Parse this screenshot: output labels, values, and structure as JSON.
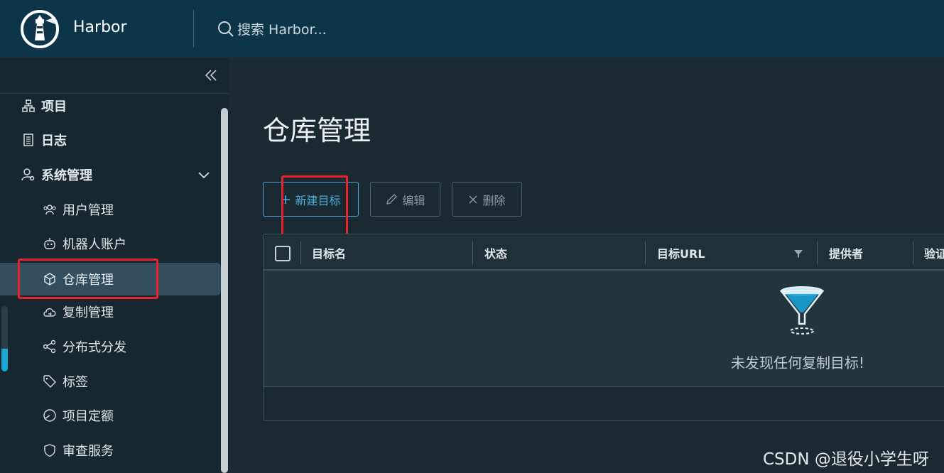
{
  "header": {
    "brand": "Harbor",
    "search_placeholder": "搜索 Harbor..."
  },
  "sidebar": {
    "items": [
      {
        "label": "项目",
        "icon": "project-icon"
      },
      {
        "label": "日志",
        "icon": "log-icon"
      },
      {
        "label": "系统管理",
        "icon": "admin-icon"
      },
      {
        "label": "用户管理",
        "icon": "users-icon"
      },
      {
        "label": "机器人账户",
        "icon": "robot-icon"
      },
      {
        "label": "仓库管理",
        "icon": "cube-icon"
      },
      {
        "label": "复制管理",
        "icon": "cloud-sync-icon"
      },
      {
        "label": "分布式分发",
        "icon": "share-icon"
      },
      {
        "label": "标签",
        "icon": "tag-icon"
      },
      {
        "label": "项目定额",
        "icon": "quota-icon"
      },
      {
        "label": "审查服务",
        "icon": "shield-icon"
      }
    ]
  },
  "main": {
    "title": "仓库管理",
    "toolbar": {
      "new_label": "新建目标",
      "edit_label": "编辑",
      "delete_label": "删除"
    },
    "table": {
      "columns": [
        "目标名",
        "状态",
        "目标URL",
        "提供者",
        "验证"
      ],
      "empty_text": "未发现任何复制目标!"
    }
  },
  "watermark": "CSDN @退役小学生呀",
  "colors": {
    "header_bg": "#0c354a",
    "sidebar_bg": "#172730",
    "accent": "#49aedb",
    "highlight": "#e8232b"
  }
}
